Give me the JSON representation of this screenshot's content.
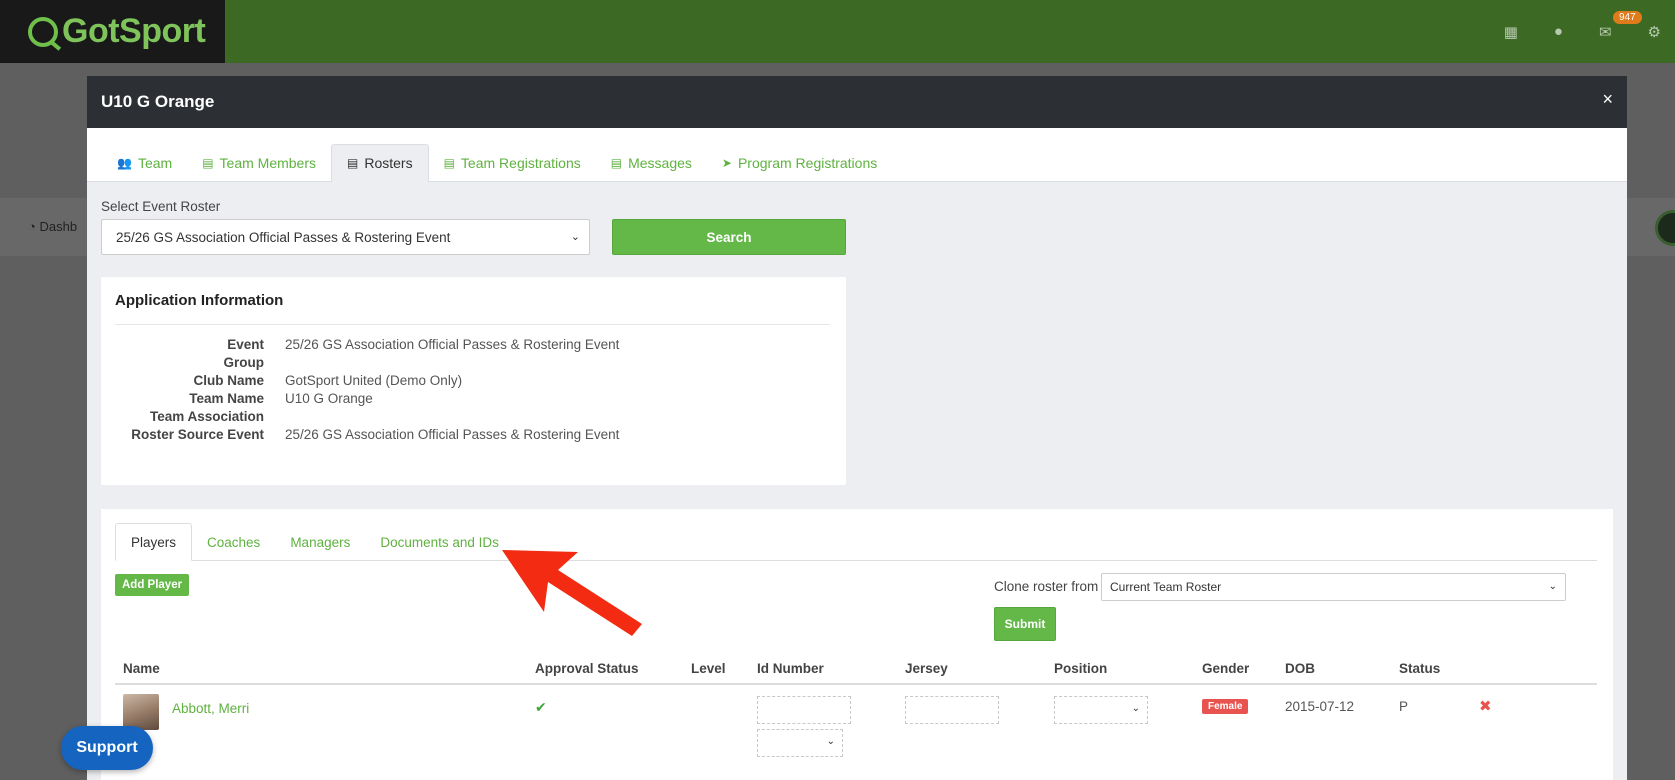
{
  "topbar": {
    "logo_text": "GotSport",
    "icons": [
      "grid-icon",
      "user-icon",
      "mail-icon",
      "gear-icon"
    ],
    "mail_badge": "947",
    "brand_color": "#3c6a24"
  },
  "background": {
    "dashboard_label": "Dashb"
  },
  "modal": {
    "title": "U10 G Orange",
    "close_glyph": "×",
    "tabs": [
      {
        "label": "Team",
        "icon": "users-icon",
        "glyph": "👥"
      },
      {
        "label": "Team Members",
        "icon": "id-card-icon",
        "glyph": "▤"
      },
      {
        "label": "Rosters",
        "icon": "id-card-icon",
        "glyph": "▤",
        "active": true
      },
      {
        "label": "Team Registrations",
        "icon": "list-icon",
        "glyph": "▤"
      },
      {
        "label": "Messages",
        "icon": "list-icon",
        "glyph": "▤"
      },
      {
        "label": "Program Registrations",
        "icon": "paper-plane-icon",
        "glyph": "➤"
      }
    ]
  },
  "event_roster": {
    "label": "Select Event Roster",
    "selected": "25/26 GS Association Official Passes & Rostering Event",
    "search_label": "Search"
  },
  "application": {
    "title": "Application Information",
    "rows": [
      {
        "key": "Event",
        "value": "25/26 GS Association Official Passes & Rostering Event"
      },
      {
        "key": "Group",
        "value": ""
      },
      {
        "key": "Club Name",
        "value": "GotSport United (Demo Only)"
      },
      {
        "key": "Team Name",
        "value": "U10 G Orange"
      },
      {
        "key": "Team Association",
        "value": ""
      },
      {
        "key": "Roster Source Event",
        "value": "25/26 GS Association Official Passes & Rostering Event"
      }
    ]
  },
  "roster": {
    "sub_tabs": [
      {
        "label": "Players",
        "active": true
      },
      {
        "label": "Coaches"
      },
      {
        "label": "Managers"
      },
      {
        "label": "Documents and IDs"
      }
    ],
    "add_player_label": "Add Player",
    "clone_label": "Clone roster from",
    "clone_selected": "Current Team Roster",
    "submit_label": "Submit",
    "columns": [
      "Name",
      "Approval Status",
      "Level",
      "Id Number",
      "Jersey",
      "Position",
      "Gender",
      "DOB",
      "Status"
    ],
    "players": [
      {
        "name": "Abbott, Merri",
        "approval_glyph": "✔",
        "gender": "Female",
        "dob": "2015-07-12",
        "status": "P",
        "remove_glyph": "✖"
      }
    ]
  },
  "support": {
    "label": "Support"
  },
  "annotation": {
    "arrow_color": "#f22b12"
  }
}
